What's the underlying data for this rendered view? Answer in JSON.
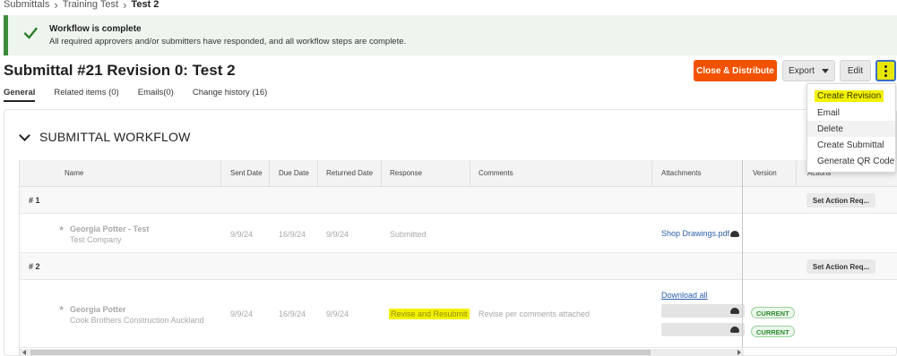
{
  "breadcrumb": {
    "items": [
      "Submittals",
      "Training Test",
      "Test 2"
    ]
  },
  "banner": {
    "title": "Workflow is complete",
    "message": "All required approvers and/or submitters have responded, and all workflow steps are complete.",
    "color": "#3a8c3a"
  },
  "header": {
    "title": "Submittal #21 Revision 0: Test 2",
    "close_distribute_label": "Close & Distribute",
    "export_label": "Export",
    "edit_label": "Edit",
    "accent_color": "#f25200"
  },
  "tabs": [
    "General",
    "Related items (0)",
    "Emails(0)",
    "Change history (16)"
  ],
  "workflow": {
    "section_title": "SUBMITTAL WORKFLOW",
    "columns": [
      "Name",
      "Sent Date",
      "Due Date",
      "Returned Date",
      "Response",
      "Comments",
      "Attachments",
      "Version",
      "Actions"
    ],
    "action_label": "Set Action Req...",
    "groups": [
      {
        "label": "# 1",
        "row": {
          "name": "Georgia Potter - Test",
          "company": "Test Company",
          "sent": "9/9/24",
          "due": "16/9/24",
          "returned": "9/9/24",
          "response": "Submitted",
          "comments": "",
          "attachment": "Shop Drawings.pdf"
        }
      },
      {
        "label": "# 2",
        "row": {
          "name": "Georgia Potter",
          "company": "Cook Brothers Construction Auckland",
          "sent": "9/9/24",
          "due": "16/9/24",
          "returned": "9/9/24",
          "response": "Revise and Resubmit",
          "comments": "Revise per comments attached",
          "attachment": "Download all",
          "versions": [
            "CURRENT",
            "CURRENT"
          ]
        }
      }
    ]
  },
  "menu": {
    "items": [
      "Create Revision",
      "Email",
      "Delete",
      "Create Submittal",
      "Generate QR Code"
    ],
    "highlight_color": "#f2f200"
  },
  "icons": {
    "check": "check-icon",
    "chevron": "chevron-down-icon",
    "breadcrumb_sep": "chevron-right-icon",
    "cloud": "cloud-download-icon",
    "more": "more-vertical-icon",
    "star": "star-icon"
  }
}
